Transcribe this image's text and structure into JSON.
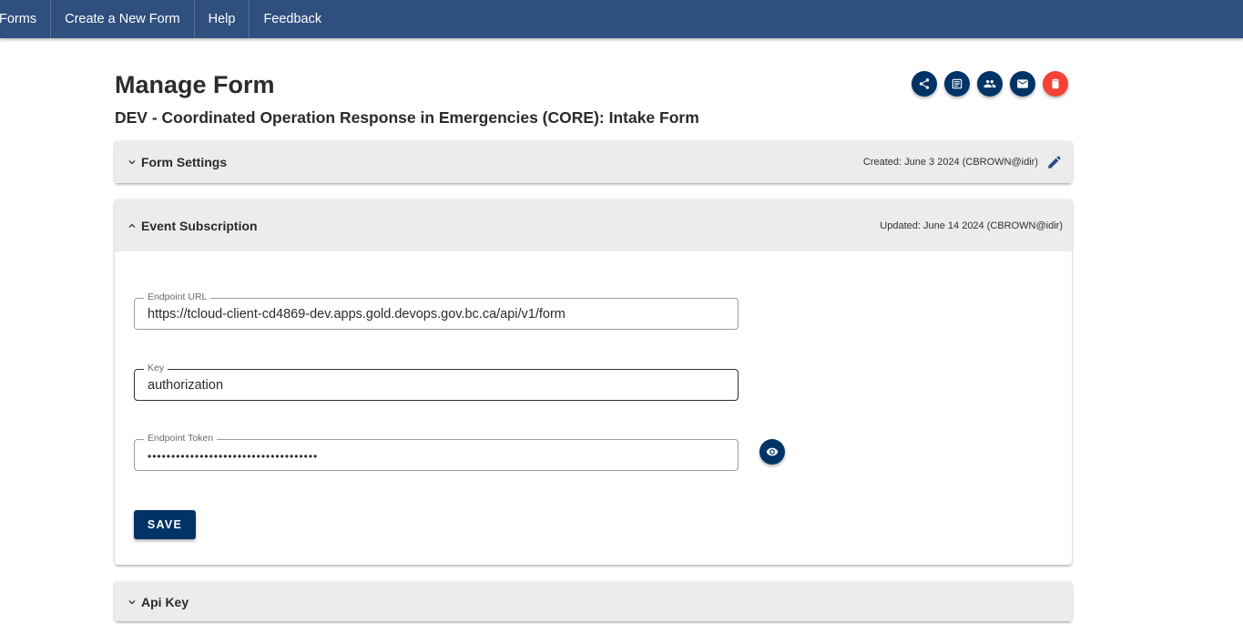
{
  "nav": {
    "items": [
      "Forms",
      "Create a New Form",
      "Help",
      "Feedback"
    ]
  },
  "page": {
    "title": "Manage Form",
    "form_name": "DEV - Coordinated Operation Response in Emergencies (CORE): Intake Form"
  },
  "actions": {
    "icons": [
      "share-icon",
      "submissions-icon",
      "team-icon",
      "email-icon",
      "delete-icon"
    ],
    "delete_color": "#f44336",
    "primary_color": "#003366"
  },
  "panels": {
    "form_settings": {
      "title": "Form Settings",
      "meta": "Created: June 3 2024 (CBROWN@idir)"
    },
    "event_subscription": {
      "title": "Event Subscription",
      "meta": "Updated: June 14 2024 (CBROWN@idir)",
      "fields": {
        "endpoint_url": {
          "label": "Endpoint URL",
          "value": "https://tcloud-client-cd4869-dev.apps.gold.devops.gov.bc.ca/api/v1/form"
        },
        "key": {
          "label": "Key",
          "value": "authorization"
        },
        "endpoint_token": {
          "label": "Endpoint Token",
          "value": "••••••••••••••••••••••••••••••••••••"
        }
      },
      "save_label": "SAVE"
    },
    "api_key": {
      "title": "Api Key"
    }
  },
  "colors": {
    "nav_bg": "#2f4f7f",
    "panel_header_bg": "#ececec"
  }
}
